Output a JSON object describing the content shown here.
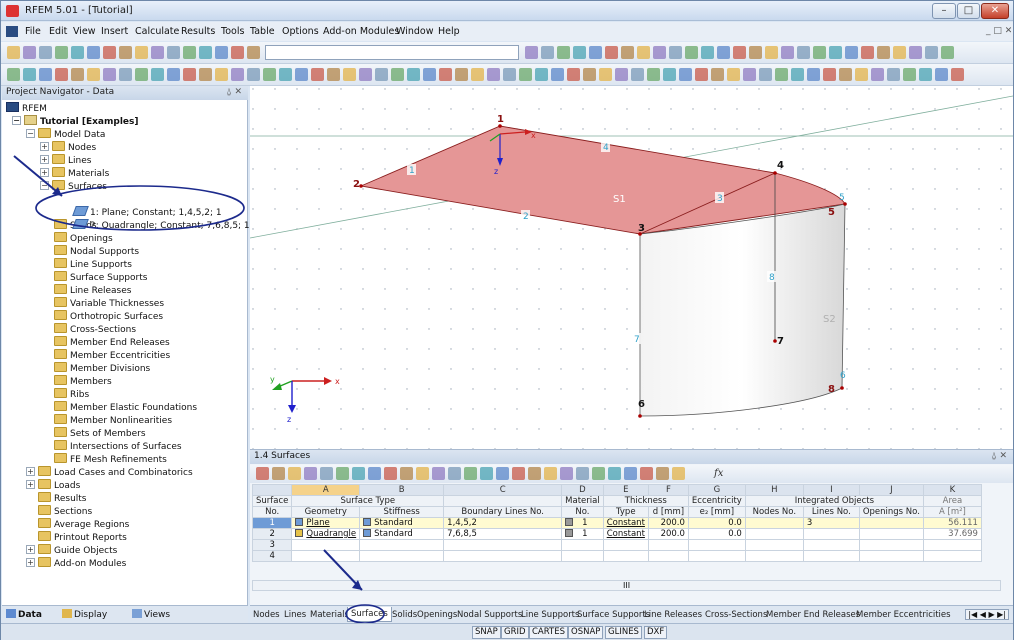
{
  "window": {
    "title": "RFEM 5.01 - [Tutorial]"
  },
  "menu": {
    "items": [
      "File",
      "Edit",
      "View",
      "Insert",
      "Calculate",
      "Results",
      "Tools",
      "Table",
      "Options",
      "Add-on Modules",
      "Window",
      "Help"
    ]
  },
  "navigator": {
    "title": "Project Navigator - Data",
    "root": "RFEM",
    "project": "Tutorial [Examples]",
    "model_data": "Model Data",
    "items": [
      "Nodes",
      "Lines",
      "Materials",
      "Surfaces",
      "Solids",
      "Openings",
      "Nodal Supports",
      "Line Supports",
      "Surface Supports",
      "Line Releases",
      "Variable Thicknesses",
      "Orthotropic Surfaces",
      "Cross-Sections",
      "Member End Releases",
      "Member Eccentricities",
      "Member Divisions",
      "Members",
      "Ribs",
      "Member Elastic Foundations",
      "Member Nonlinearities",
      "Sets of Members",
      "Intersections of Surfaces",
      "FE Mesh Refinements"
    ],
    "surfaces_children": [
      "1: Plane; Constant; 1,4,5,2; 1",
      "2: Quadrangle; Constant; 7,6,8,5; 1"
    ],
    "top_items": [
      "Load Cases and Combinatorics",
      "Loads",
      "Results",
      "Sections",
      "Average Regions",
      "Printout Reports",
      "Guide Objects",
      "Add-on Modules"
    ],
    "tabs": [
      "Data",
      "Display",
      "Views"
    ]
  },
  "viewport": {
    "node_labels": [
      "1",
      "2",
      "3",
      "4",
      "5",
      "6",
      "7",
      "8"
    ],
    "line_labels": [
      "1",
      "2",
      "3",
      "4",
      "5",
      "6",
      "7",
      "8"
    ],
    "surface_labels": [
      "S1",
      "S2"
    ],
    "axis_labels": {
      "x": "x",
      "y": "y",
      "z": "z"
    }
  },
  "table": {
    "title": "1.4 Surfaces",
    "col_letters": [
      "A",
      "B",
      "C",
      "D",
      "E",
      "F",
      "G",
      "H",
      "I",
      "J",
      "K"
    ],
    "group_headers": {
      "surface_type": "Surface Type",
      "material": "Material",
      "thickness": "Thickness",
      "eccentricity": "Eccentricity",
      "integrated": "Integrated Objects",
      "area": "Area"
    },
    "headers": {
      "surface": "Surface",
      "no": "No.",
      "geometry": "Geometry",
      "stiffness": "Stiffness",
      "boundary": "Boundary Lines No.",
      "mat_no": "No.",
      "type": "Type",
      "d": "d [mm]",
      "ez": "e₂ [mm]",
      "nodes": "Nodes No.",
      "lines": "Lines No.",
      "openings": "Openings No.",
      "a": "A [m²]"
    },
    "rows": [
      {
        "no": "1",
        "geometry": "Plane",
        "stiffness": "Standard",
        "boundary": "1,4,5,2",
        "mat": "1",
        "type": "Constant",
        "d": "200.0",
        "ez": "0.0",
        "nodes": "",
        "lines": "3",
        "openings": "",
        "area": "56.111"
      },
      {
        "no": "2",
        "geometry": "Quadrangle",
        "stiffness": "Standard",
        "boundary": "7,6,8,5",
        "mat": "1",
        "type": "Constant",
        "d": "200.0",
        "ez": "0.0",
        "nodes": "",
        "lines": "",
        "openings": "",
        "area": "37.699"
      },
      {
        "no": "3",
        "geometry": "",
        "stiffness": "",
        "boundary": "",
        "mat": "",
        "type": "",
        "d": "",
        "ez": "",
        "nodes": "",
        "lines": "",
        "openings": "",
        "area": ""
      },
      {
        "no": "4",
        "geometry": "",
        "stiffness": "",
        "boundary": "",
        "mat": "",
        "type": "",
        "d": "",
        "ez": "",
        "nodes": "",
        "lines": "",
        "openings": "",
        "area": ""
      }
    ],
    "tabs": [
      "Nodes",
      "Lines",
      "Materials",
      "Surfaces",
      "Solids",
      "Openings",
      "Nodal Supports",
      "Line Supports",
      "Surface Supports",
      "Line Releases",
      "Cross-Sections",
      "Member End Releases",
      "Member Eccentricities"
    ],
    "scroll_mark": "III"
  },
  "status": {
    "buttons": [
      "SNAP",
      "GRID",
      "CARTES",
      "OSNAP",
      "GLINES",
      "DXF"
    ]
  },
  "colors": {
    "accent": "#1c2a8c",
    "surface_fill": "#e59696",
    "selected_row": "#fffbd1"
  }
}
